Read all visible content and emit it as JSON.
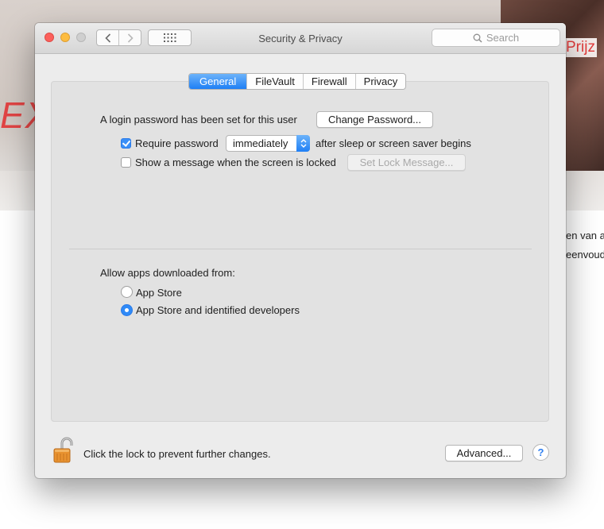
{
  "background_page": {
    "heading_fragment": "Prijz",
    "hero_fragment": "EX",
    "text_lines": [
      "en van a",
      "eenvoud"
    ]
  },
  "window": {
    "title": "Security & Privacy",
    "search_placeholder": "Search"
  },
  "tabs": [
    {
      "label": "General",
      "active": true
    },
    {
      "label": "FileVault",
      "active": false
    },
    {
      "label": "Firewall",
      "active": false
    },
    {
      "label": "Privacy",
      "active": false
    }
  ],
  "general": {
    "login_password_text": "A login password has been set for this user",
    "change_password_label": "Change Password...",
    "require_password_label": "Require password",
    "require_password_checked": true,
    "require_password_delay": "immediately",
    "after_sleep_text": "after sleep or screen saver begins",
    "show_message_label": "Show a message when the screen is locked",
    "show_message_checked": false,
    "set_lock_message_label": "Set Lock Message..."
  },
  "allow_apps": {
    "heading": "Allow apps downloaded from:",
    "options": [
      {
        "label": "App Store",
        "selected": false
      },
      {
        "label": "App Store and identified developers",
        "selected": true
      }
    ]
  },
  "footer": {
    "lock_text": "Click the lock to prevent further changes.",
    "advanced_label": "Advanced...",
    "help_label": "?"
  },
  "colors": {
    "accent": "#2f8af7",
    "close": "#fc605c",
    "minimize": "#fdbc40",
    "zoom_disabled": "#cfcfcf",
    "lock_body": "#e8922f"
  }
}
